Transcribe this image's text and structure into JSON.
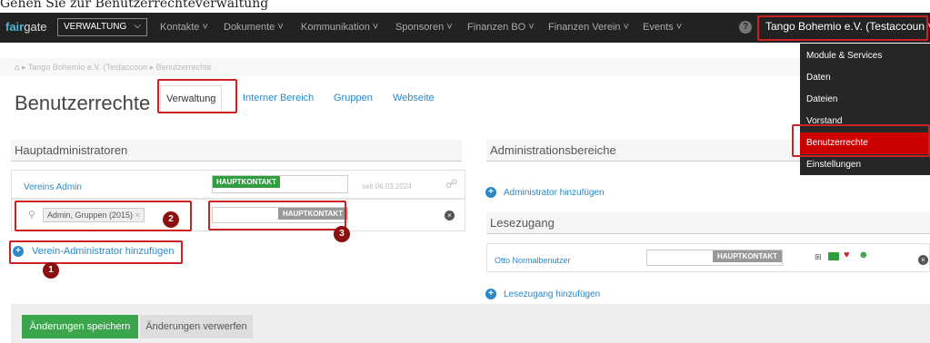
{
  "instruction": "Gehen Sie zur Benutzerrechteverwaltung",
  "topbar": {
    "logo_fair": "fair",
    "logo_gate": "gate",
    "app_select": "VERWALTUNG",
    "menu": [
      "Kontakte",
      "Dokumente",
      "Kommunikation",
      "Sponsoren",
      "Finanzen BO",
      "Finanzen Verein",
      "Events"
    ],
    "help": "?",
    "account": "Tango Bohemio e.V. (Testaccoun"
  },
  "breadcrumb": "Tango Bohemio e.V. (Testaccoun",
  "breadcrumb_current": "Benutzerrechte",
  "page_title": "Benutzerrechte",
  "tabs": [
    "Verwaltung",
    "Interner Bereich",
    "Gruppen",
    "Webseite"
  ],
  "hauptadmins": {
    "title": "Hauptadministratoren",
    "row1_name": "Vereins Admin",
    "row1_badge": "HAUPTKONTAKT",
    "row1_date": "seit 06.03.2024",
    "row2_tag": "Admin, Gruppen (2015)",
    "row2_badge": "HAUPTKONTAKT",
    "add_link": "Verein-Administrator hinzufügen"
  },
  "adminbereiche": {
    "title": "Administrationsbereiche",
    "add_link": "Administrator hinzufügen"
  },
  "lesezugang": {
    "title": "Lesezugang",
    "row_name": "Otto Normalbenutzer",
    "row_badge": "HAUPTKONTAKT",
    "add_link": "Lesezugang hinzufügen"
  },
  "dropdown": [
    "Module & Services",
    "Daten",
    "Dateien",
    "Vorstand",
    "Benutzerrechte",
    "Einstellungen"
  ],
  "numbers": [
    "1",
    "2",
    "3"
  ],
  "footer": {
    "save": "Änderungen speichern",
    "discard": "Änderungen verwerfen"
  }
}
